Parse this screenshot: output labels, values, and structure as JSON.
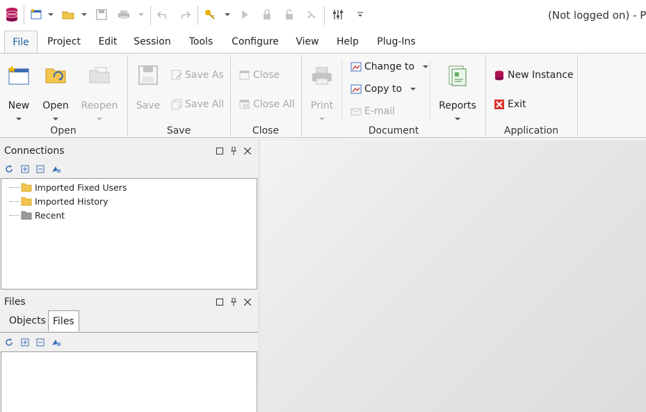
{
  "window": {
    "title": "(Not logged on) - P"
  },
  "menu_tabs": [
    {
      "label": "File",
      "active": true
    },
    {
      "label": "Project"
    },
    {
      "label": "Edit"
    },
    {
      "label": "Session"
    },
    {
      "label": "Tools"
    },
    {
      "label": "Configure"
    },
    {
      "label": "View"
    },
    {
      "label": "Help"
    },
    {
      "label": "Plug-Ins"
    }
  ],
  "ribbon": {
    "groups": {
      "open": {
        "label": "Open",
        "new": "New",
        "open": "Open",
        "reopen": "Reopen"
      },
      "save": {
        "label": "Save",
        "save": "Save",
        "save_as": "Save As",
        "save_all": "Save All"
      },
      "close": {
        "label": "Close",
        "close": "Close",
        "close_all": "Close All"
      },
      "document": {
        "label": "Document",
        "print": "Print",
        "change_to": "Change to",
        "copy_to": "Copy to",
        "email": "E-mail",
        "reports": "Reports"
      },
      "application": {
        "label": "Application",
        "new_instance": "New Instance",
        "exit": "Exit"
      }
    }
  },
  "connections_panel": {
    "title": "Connections",
    "items": [
      {
        "label": "Imported Fixed Users",
        "icon": "folder-icon"
      },
      {
        "label": "Imported History",
        "icon": "folder-icon"
      },
      {
        "label": "Recent",
        "icon": "folder-gray-icon"
      }
    ]
  },
  "files_panel": {
    "title": "Files",
    "tabs": [
      {
        "label": "Objects"
      },
      {
        "label": "Files",
        "active": true
      }
    ]
  },
  "colors": {
    "accent": "#1b5fa8",
    "folder": "#f3c54f",
    "exit_red": "#d9342b",
    "disabled": "#a8a8a8"
  }
}
